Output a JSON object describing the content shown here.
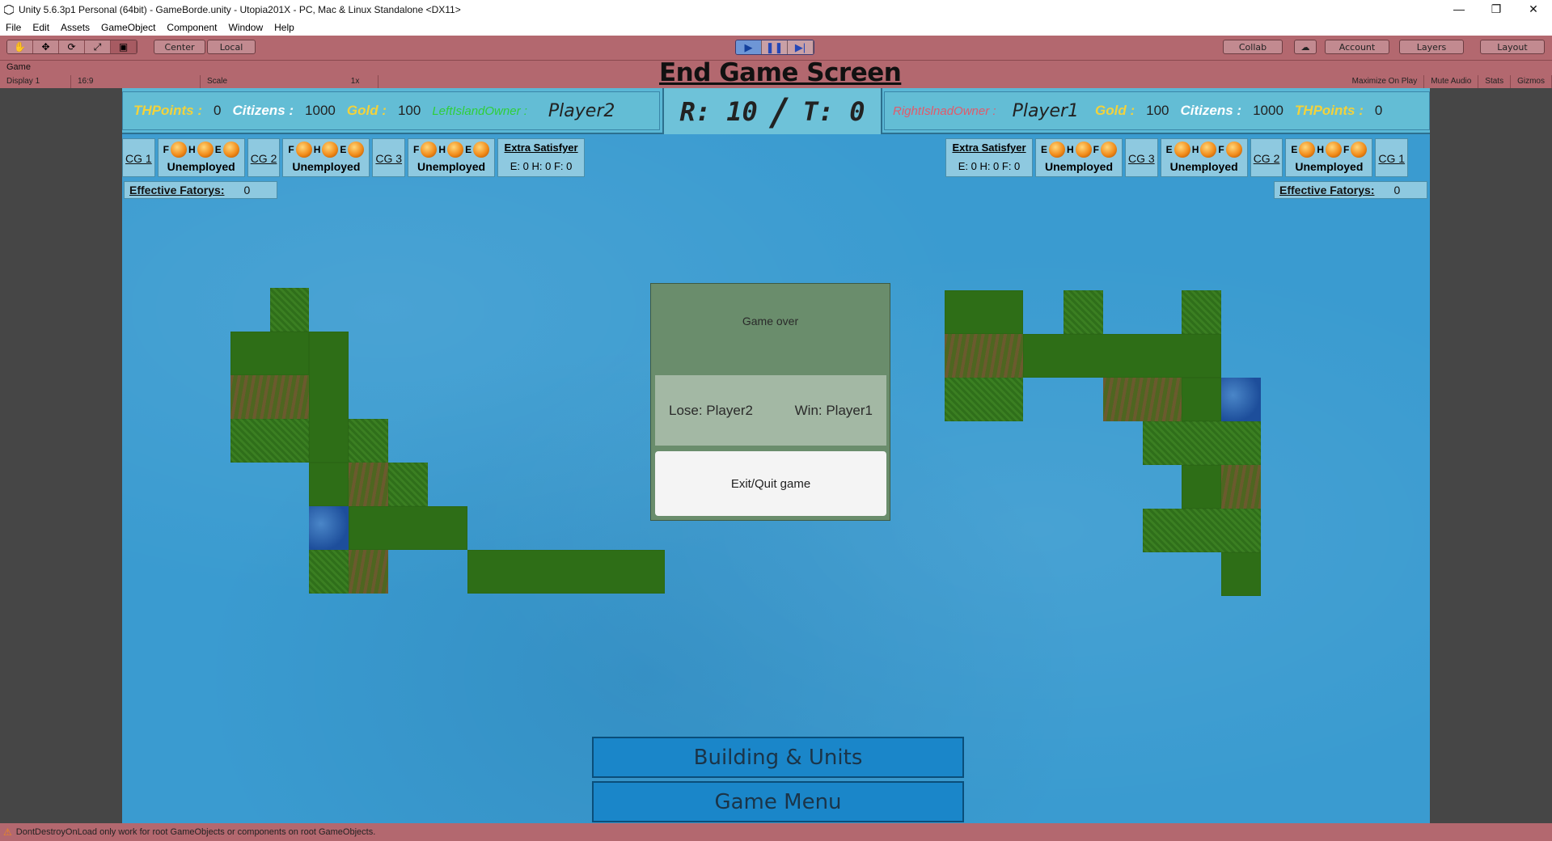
{
  "window": {
    "title": "Unity 5.6.3p1 Personal (64bit) - GameBorde.unity - Utopia201X - PC, Mac & Linux Standalone <DX11>",
    "minimize": "—",
    "restore": "❐",
    "close": "✕"
  },
  "menu": [
    "File",
    "Edit",
    "Assets",
    "GameObject",
    "Component",
    "Window",
    "Help"
  ],
  "toolbar": {
    "tools": [
      "✋",
      "✥",
      "⟳",
      "⤢",
      "▣"
    ],
    "center": "Center",
    "local": "Local",
    "play": "▶",
    "pause": "❚❚",
    "step": "▶|",
    "collab": "Collab",
    "cloud": "☁",
    "account": "Account",
    "layers": "Layers",
    "layout": "Layout"
  },
  "gameview": {
    "tab": "Game",
    "display": "Display 1",
    "aspect": "16:9",
    "scale_label": "Scale",
    "scale_value": "1x",
    "maximize": "Maximize On Play",
    "mute": "Mute Audio",
    "stats": "Stats",
    "gizmos": "Gizmos"
  },
  "heading": "End Game Screen",
  "hud": {
    "left": {
      "thpoints_label": "THPoints :",
      "thpoints": "0",
      "citizens_label": "Citizens :",
      "citizens": "1000",
      "gold_label": "Gold :",
      "gold": "100",
      "owner_label": "LeftIslandOwner :",
      "owner": "Player2"
    },
    "round": "R: 10",
    "sep": "/",
    "turn": "T: 0",
    "right": {
      "owner_label": "RightIslnadOwner :",
      "owner": "Player1",
      "gold_label": "Gold :",
      "gold": "100",
      "citizens_label": "Citizens :",
      "citizens": "1000",
      "thpoints_label": "THPoints :",
      "thpoints": "0"
    }
  },
  "left_cg": {
    "cg1": "CG 1",
    "cg2": "CG 2",
    "cg3": "CG 3",
    "status": "Unemployed",
    "letters1": [
      "F",
      "H",
      "E"
    ],
    "extra_title": "Extra Satisfyer",
    "extra_vals": "E: 0  H: 0  F: 0",
    "eff_label": "Effective Fatorys:",
    "eff": "0"
  },
  "right_cg": {
    "cg1": "CG 1",
    "cg2": "CG 2",
    "cg3": "CG 3",
    "status": "Unemployed",
    "letters": [
      "E",
      "H",
      "F"
    ],
    "extra_title": "Extra Satisfyer",
    "extra_vals": "E: 0  H: 0  F: 0",
    "eff_label": "Effective Fatorys:",
    "eff": "0"
  },
  "modal": {
    "title": "Game over",
    "lose": "Lose: Player2",
    "win": "Win: Player1",
    "button": "Exit/Quit game"
  },
  "buttons": {
    "building": "Building & Units",
    "menu": "Game Menu"
  },
  "status": "DontDestroyOnLoad only work for root GameObjects or components on root GameObjects.",
  "colors": {
    "playmode_tint": "#b3686f",
    "water": "#3a9bd0",
    "grass": "#2e6e17",
    "modal": "#6a8d6c",
    "button": "#1a86c9"
  }
}
